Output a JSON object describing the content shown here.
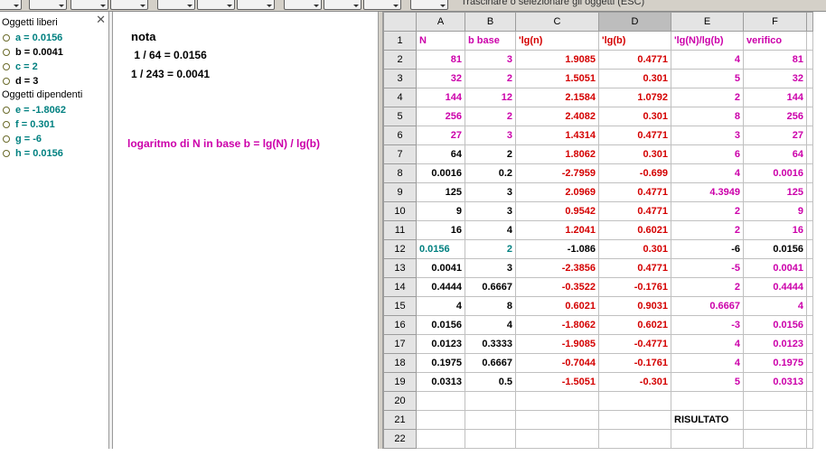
{
  "colors": {
    "magenta": "#cc00aa",
    "red": "#d40000",
    "teal": "#008080",
    "black": "#000000"
  },
  "toolbar": {
    "hint": "Trascinare o selezionare gli oggetti (ESC)",
    "tools": [
      "move-tool",
      "point-tool",
      "line-tool",
      "perpendicular-tool",
      "polygon-tool",
      "circle-tool",
      "conic-tool",
      "angle-tool",
      "reflect-tool",
      "slider-tool",
      "move-view-tool"
    ]
  },
  "algebra": {
    "free_header": "Oggetti liberi",
    "free": [
      {
        "label": "a = 0.0156",
        "color": "teal"
      },
      {
        "label": "b = 0.0041",
        "color": "black"
      },
      {
        "label": "c = 2",
        "color": "teal"
      },
      {
        "label": "d = 3",
        "color": "black"
      }
    ],
    "dependent_header": "Oggetti dipendenti",
    "dependent": [
      {
        "label": "e = -1.8062",
        "color": "teal"
      },
      {
        "label": "f = 0.301",
        "color": "teal"
      },
      {
        "label": "g = -6",
        "color": "teal"
      },
      {
        "label": "h = 0.0156",
        "color": "teal"
      }
    ]
  },
  "graphics": {
    "nota": "nota",
    "line1": " 1 / 64 = 0.0156",
    "line2": "1 / 243 = 0.0041",
    "formula": "logaritmo di N in base b = lg(N) / lg(b)"
  },
  "sheet": {
    "columns": [
      "A",
      "B",
      "C",
      "D",
      "E",
      "F"
    ],
    "selected_column": "D",
    "rows": [
      {
        "n": "1",
        "cells": [
          [
            "N",
            "magenta",
            "l"
          ],
          [
            "b base",
            "magenta",
            "l"
          ],
          [
            "'lg(n)",
            "red",
            "l"
          ],
          [
            "'lg(b)",
            "red",
            "l"
          ],
          [
            "'lg(N)/lg(b)",
            "magenta",
            "l"
          ],
          [
            "verifico",
            "magenta",
            "l"
          ]
        ]
      },
      {
        "n": "2",
        "cells": [
          [
            "81",
            "magenta",
            "r"
          ],
          [
            "3",
            "magenta",
            "r"
          ],
          [
            "1.9085",
            "red",
            "r"
          ],
          [
            "0.4771",
            "red",
            "r"
          ],
          [
            "4",
            "magenta",
            "r"
          ],
          [
            "81",
            "magenta",
            "r"
          ]
        ]
      },
      {
        "n": "3",
        "cells": [
          [
            "32",
            "magenta",
            "r"
          ],
          [
            "2",
            "magenta",
            "r"
          ],
          [
            "1.5051",
            "red",
            "r"
          ],
          [
            "0.301",
            "red",
            "r"
          ],
          [
            "5",
            "magenta",
            "r"
          ],
          [
            "32",
            "magenta",
            "r"
          ]
        ]
      },
      {
        "n": "4",
        "cells": [
          [
            "144",
            "magenta",
            "r"
          ],
          [
            "12",
            "magenta",
            "r"
          ],
          [
            "2.1584",
            "red",
            "r"
          ],
          [
            "1.0792",
            "red",
            "r"
          ],
          [
            "2",
            "magenta",
            "r"
          ],
          [
            "144",
            "magenta",
            "r"
          ]
        ]
      },
      {
        "n": "5",
        "cells": [
          [
            "256",
            "magenta",
            "r"
          ],
          [
            "2",
            "magenta",
            "r"
          ],
          [
            "2.4082",
            "red",
            "r"
          ],
          [
            "0.301",
            "red",
            "r"
          ],
          [
            "8",
            "magenta",
            "r"
          ],
          [
            "256",
            "magenta",
            "r"
          ]
        ]
      },
      {
        "n": "6",
        "cells": [
          [
            "27",
            "magenta",
            "r"
          ],
          [
            "3",
            "magenta",
            "r"
          ],
          [
            "1.4314",
            "red",
            "r"
          ],
          [
            "0.4771",
            "red",
            "r"
          ],
          [
            "3",
            "magenta",
            "r"
          ],
          [
            "27",
            "magenta",
            "r"
          ]
        ]
      },
      {
        "n": "7",
        "cells": [
          [
            "64",
            "black",
            "r"
          ],
          [
            "2",
            "black",
            "r"
          ],
          [
            "1.8062",
            "red",
            "r"
          ],
          [
            "0.301",
            "red",
            "r"
          ],
          [
            "6",
            "magenta",
            "r"
          ],
          [
            "64",
            "magenta",
            "r"
          ]
        ]
      },
      {
        "n": "8",
        "cells": [
          [
            "0.0016",
            "black",
            "r"
          ],
          [
            "0.2",
            "black",
            "r"
          ],
          [
            "-2.7959",
            "red",
            "r"
          ],
          [
            "-0.699",
            "red",
            "r"
          ],
          [
            "4",
            "magenta",
            "r"
          ],
          [
            "0.0016",
            "magenta",
            "r"
          ]
        ]
      },
      {
        "n": "9",
        "cells": [
          [
            "125",
            "black",
            "r"
          ],
          [
            "3",
            "black",
            "r"
          ],
          [
            "2.0969",
            "red",
            "r"
          ],
          [
            "0.4771",
            "red",
            "r"
          ],
          [
            "4.3949",
            "magenta",
            "r"
          ],
          [
            "125",
            "magenta",
            "r"
          ]
        ]
      },
      {
        "n": "10",
        "cells": [
          [
            "9",
            "black",
            "r"
          ],
          [
            "3",
            "black",
            "r"
          ],
          [
            "0.9542",
            "red",
            "r"
          ],
          [
            "0.4771",
            "red",
            "r"
          ],
          [
            "2",
            "magenta",
            "r"
          ],
          [
            "9",
            "magenta",
            "r"
          ]
        ]
      },
      {
        "n": "11",
        "cells": [
          [
            "16",
            "black",
            "r"
          ],
          [
            "4",
            "black",
            "r"
          ],
          [
            "1.2041",
            "red",
            "r"
          ],
          [
            "0.6021",
            "red",
            "r"
          ],
          [
            "2",
            "magenta",
            "r"
          ],
          [
            "16",
            "magenta",
            "r"
          ]
        ]
      },
      {
        "n": "12",
        "cells": [
          [
            "0.0156",
            "teal",
            "l"
          ],
          [
            "2",
            "teal",
            "r"
          ],
          [
            "-1.086",
            "black",
            "r"
          ],
          [
            "0.301",
            "red",
            "r"
          ],
          [
            "-6",
            "black",
            "r"
          ],
          [
            "0.0156",
            "black",
            "r"
          ]
        ]
      },
      {
        "n": "13",
        "cells": [
          [
            "0.0041",
            "black",
            "r"
          ],
          [
            "3",
            "black",
            "r"
          ],
          [
            "-2.3856",
            "red",
            "r"
          ],
          [
            "0.4771",
            "red",
            "r"
          ],
          [
            "-5",
            "magenta",
            "r"
          ],
          [
            "0.0041",
            "magenta",
            "r"
          ]
        ]
      },
      {
        "n": "14",
        "cells": [
          [
            "0.4444",
            "black",
            "r"
          ],
          [
            "0.6667",
            "black",
            "r"
          ],
          [
            "-0.3522",
            "red",
            "r"
          ],
          [
            "-0.1761",
            "red",
            "r"
          ],
          [
            "2",
            "magenta",
            "r"
          ],
          [
            "0.4444",
            "magenta",
            "r"
          ]
        ]
      },
      {
        "n": "15",
        "cells": [
          [
            "4",
            "black",
            "r"
          ],
          [
            "8",
            "black",
            "r"
          ],
          [
            "0.6021",
            "red",
            "r"
          ],
          [
            "0.9031",
            "red",
            "r"
          ],
          [
            "0.6667",
            "magenta",
            "r"
          ],
          [
            "4",
            "magenta",
            "r"
          ]
        ]
      },
      {
        "n": "16",
        "cells": [
          [
            "0.0156",
            "black",
            "r"
          ],
          [
            "4",
            "black",
            "r"
          ],
          [
            "-1.8062",
            "red",
            "r"
          ],
          [
            "0.6021",
            "red",
            "r"
          ],
          [
            "-3",
            "magenta",
            "r"
          ],
          [
            "0.0156",
            "magenta",
            "r"
          ]
        ]
      },
      {
        "n": "17",
        "cells": [
          [
            "0.0123",
            "black",
            "r"
          ],
          [
            "0.3333",
            "black",
            "r"
          ],
          [
            "-1.9085",
            "red",
            "r"
          ],
          [
            "-0.4771",
            "red",
            "r"
          ],
          [
            "4",
            "magenta",
            "r"
          ],
          [
            "0.0123",
            "magenta",
            "r"
          ]
        ]
      },
      {
        "n": "18",
        "cells": [
          [
            "0.1975",
            "black",
            "r"
          ],
          [
            "0.6667",
            "black",
            "r"
          ],
          [
            "-0.7044",
            "red",
            "r"
          ],
          [
            "-0.1761",
            "red",
            "r"
          ],
          [
            "4",
            "magenta",
            "r"
          ],
          [
            "0.1975",
            "magenta",
            "r"
          ]
        ]
      },
      {
        "n": "19",
        "cells": [
          [
            "0.0313",
            "black",
            "r"
          ],
          [
            "0.5",
            "black",
            "r"
          ],
          [
            "-1.5051",
            "red",
            "r"
          ],
          [
            "-0.301",
            "red",
            "r"
          ],
          [
            "5",
            "magenta",
            "r"
          ],
          [
            "0.0313",
            "magenta",
            "r"
          ]
        ]
      },
      {
        "n": "20",
        "cells": [
          [
            "",
            "black",
            "l"
          ],
          [
            "",
            "black",
            "l"
          ],
          [
            "",
            "black",
            "l"
          ],
          [
            "",
            "black",
            "l"
          ],
          [
            "",
            "black",
            "l"
          ],
          [
            "",
            "black",
            "l"
          ]
        ]
      },
      {
        "n": "21",
        "cells": [
          [
            "",
            "black",
            "l"
          ],
          [
            "",
            "black",
            "l"
          ],
          [
            "",
            "black",
            "l"
          ],
          [
            "",
            "black",
            "l"
          ],
          [
            "RISULTATO",
            "black",
            "l"
          ],
          [
            "",
            "black",
            "l"
          ]
        ]
      },
      {
        "n": "22",
        "cells": [
          [
            "",
            "black",
            "l"
          ],
          [
            "",
            "black",
            "l"
          ],
          [
            "",
            "black",
            "l"
          ],
          [
            "",
            "black",
            "l"
          ],
          [
            "",
            "black",
            "l"
          ],
          [
            "",
            "black",
            "l"
          ]
        ]
      }
    ]
  }
}
